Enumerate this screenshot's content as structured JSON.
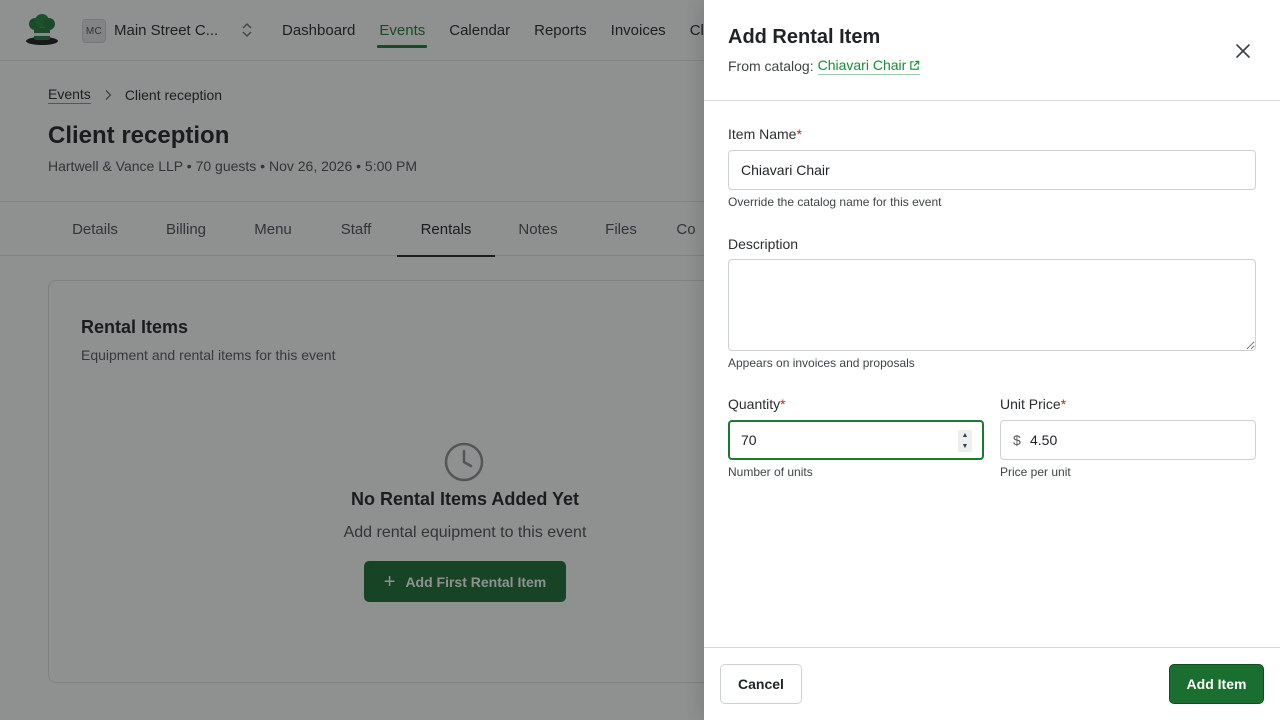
{
  "app": {
    "org_avatar": "MC",
    "org_name": "Main Street C...",
    "nav": [
      "Dashboard",
      "Events",
      "Calendar",
      "Reports",
      "Invoices",
      "Cl"
    ],
    "active_nav": "Events"
  },
  "breadcrumb": {
    "parent": "Events",
    "current": "Client reception"
  },
  "event": {
    "title": "Client reception",
    "subtitle": "Hartwell & Vance LLP • 70 guests • Nov 26, 2026 • 5:00 PM"
  },
  "tabs": [
    "Details",
    "Billing",
    "Menu",
    "Staff",
    "Rentals",
    "Notes",
    "Files",
    "Co"
  ],
  "active_tab": "Rentals",
  "rentals_card": {
    "title": "Rental Items",
    "subtitle": "Equipment and rental items for this event",
    "empty_title": "No Rental Items Added Yet",
    "empty_subtitle": "Add rental equipment to this event",
    "empty_button": "Add First Rental Item"
  },
  "drawer": {
    "title": "Add Rental Item",
    "catalog_prefix": "From catalog:",
    "catalog_item": "Chiavari Chair",
    "fields": {
      "item_name": {
        "label": "Item Name",
        "required_mark": "*",
        "value": "Chiavari Chair",
        "hint": "Override the catalog name for this event"
      },
      "description": {
        "label": "Description",
        "value": "",
        "hint": "Appears on invoices and proposals"
      },
      "quantity": {
        "label": "Quantity",
        "required_mark": "*",
        "value": "70",
        "hint": "Number of units"
      },
      "unit_price": {
        "label": "Unit Price",
        "required_mark": "*",
        "currency": "$",
        "value": "4.50",
        "hint": "Price per unit"
      }
    },
    "cancel_label": "Cancel",
    "submit_label": "Add Item"
  },
  "colors": {
    "accent": "#1a7a34",
    "primary_button": "#1a6e30",
    "required": "#c8202a",
    "overlay": "rgba(20,22,24,0.48)"
  },
  "icons": {
    "logo": "chef-hat-logo",
    "org_switch": "chevron-up-down-icon",
    "breadcrumb_sep": "chevron-right-icon",
    "empty_state": "clock-icon",
    "add": "plus-icon",
    "external_link": "external-link-icon",
    "close": "close-icon"
  }
}
